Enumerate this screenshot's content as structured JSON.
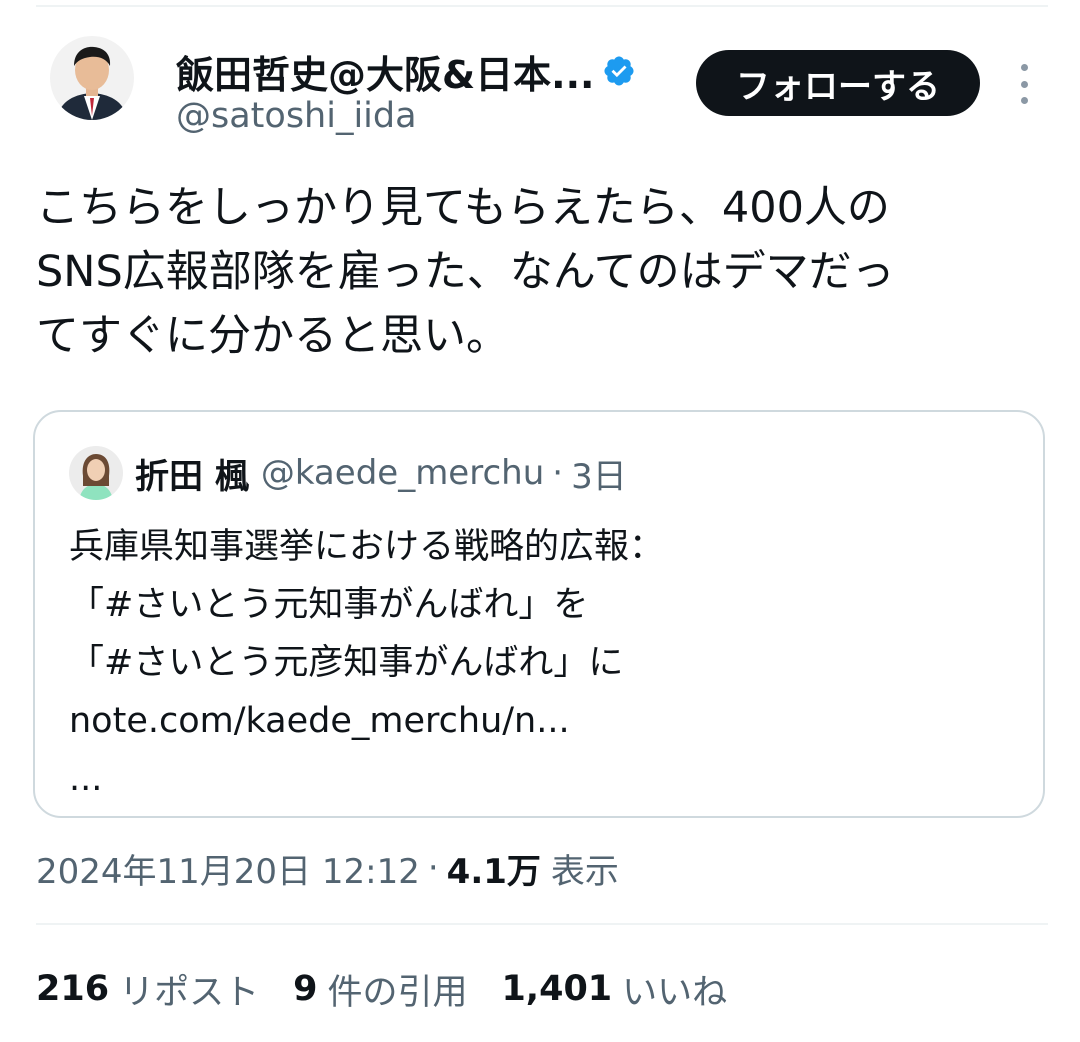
{
  "author": {
    "display_name": "飯田哲史@大阪&日本...",
    "handle": "@satoshi_iida",
    "verified": true
  },
  "follow_label": "フォローする",
  "tweet_lines": [
    "こちらをしっかり見てもらえたら、400人の",
    "SNS広報部隊を雇った、なんてのはデマだっ",
    "てすぐに分かると思い。"
  ],
  "quoted": {
    "name": "折田 楓",
    "handle": "@kaede_merchu",
    "time": "3日",
    "lines": [
      "兵庫県知事選挙における戦略的広報：",
      "「#さいとう元知事がんばれ」を",
      "「#さいとう元彦知事がんばれ」に",
      "note.com/kaede_merchu/n...",
      "..."
    ]
  },
  "timestamp": "2024年11月20日 12:12",
  "views_count": "4.1万",
  "views_label": "表示",
  "stats": {
    "reposts_count": "216",
    "reposts_label": "リポスト",
    "quotes_count": "9",
    "quotes_label": "件の引用",
    "likes_count": "1,401",
    "likes_label": "いいね"
  },
  "colors": {
    "text_primary": "#0f1419",
    "text_secondary": "#536471",
    "verified_badge": "#1d9bf0",
    "follow_bg": "#0f1419",
    "border": "#cfd9de"
  },
  "icons": {
    "verified": "verified-badge-icon",
    "more": "more-options-icon"
  }
}
